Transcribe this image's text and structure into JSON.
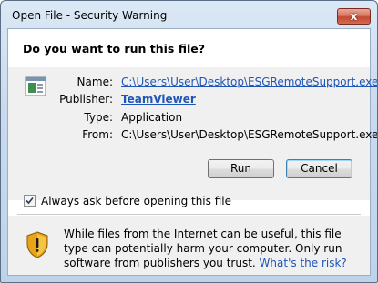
{
  "window": {
    "title": "Open File - Security Warning",
    "close_glyph": "x"
  },
  "header": {
    "question": "Do you want to run this file?"
  },
  "details": {
    "name_label": "Name:",
    "name_value": "C:\\Users\\User\\Desktop\\ESGRemoteSupport.exe",
    "publisher_label": "Publisher:",
    "publisher_value": "TeamViewer",
    "type_label": "Type:",
    "type_value": "Application",
    "from_label": "From:",
    "from_value": "C:\\Users\\User\\Desktop\\ESGRemoteSupport.exe",
    "file_icon": "application-file-icon"
  },
  "buttons": {
    "run_label": "Run",
    "cancel_label": "Cancel"
  },
  "checkbox": {
    "label": "Always ask before opening this file",
    "checked": true
  },
  "warning": {
    "text": "While files from the Internet can be useful, this file type can potentially harm your computer. Only run software from publishers you trust.",
    "link_text": "What's the risk?",
    "icon": "shield-warning-icon"
  },
  "colors": {
    "link": "#1f55b8",
    "titlebar": "#c9daee",
    "close_button": "#c24a33"
  }
}
